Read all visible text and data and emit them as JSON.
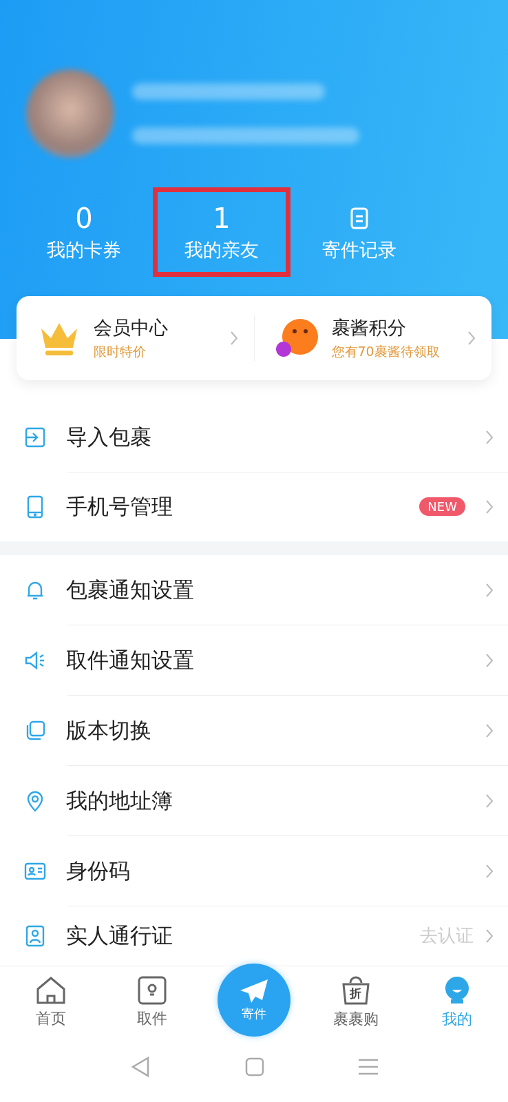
{
  "stats": [
    {
      "kind": "number",
      "value": "0",
      "label": "我的卡券",
      "highlighted": false
    },
    {
      "kind": "number",
      "value": "1",
      "label": "我的亲友",
      "highlighted": true
    },
    {
      "kind": "icon",
      "label": "寄件记录",
      "highlighted": false
    }
  ],
  "promo": [
    {
      "kind": "crown",
      "title": "会员中心",
      "subtitle": "限时特价"
    },
    {
      "kind": "mascot",
      "title": "裹酱积分",
      "subtitle": "您有70裹酱待领取"
    }
  ],
  "menu_groups": [
    [
      {
        "kind": "import",
        "label": "导入包裹"
      },
      {
        "kind": "phone",
        "label": "手机号管理",
        "badge": "NEW"
      }
    ],
    [
      {
        "kind": "bell",
        "label": "包裹通知设置"
      },
      {
        "kind": "speaker",
        "label": "取件通知设置"
      },
      {
        "kind": "layers",
        "label": "版本切换"
      },
      {
        "kind": "pin",
        "label": "我的地址簿"
      },
      {
        "kind": "idcard",
        "label": "身份码"
      },
      {
        "kind": "person",
        "label": "实人通行证",
        "trailing": "去认证"
      }
    ]
  ],
  "tab_bar": [
    {
      "kind": "home",
      "label": "首页",
      "selected": false
    },
    {
      "kind": "locker",
      "label": "取件",
      "selected": false
    },
    {
      "kind": "send",
      "label": "寄件",
      "selected": false
    },
    {
      "kind": "bag",
      "label": "裹裹购",
      "selected": false,
      "glyph": "折"
    },
    {
      "kind": "me",
      "label": "我的",
      "selected": true
    }
  ]
}
